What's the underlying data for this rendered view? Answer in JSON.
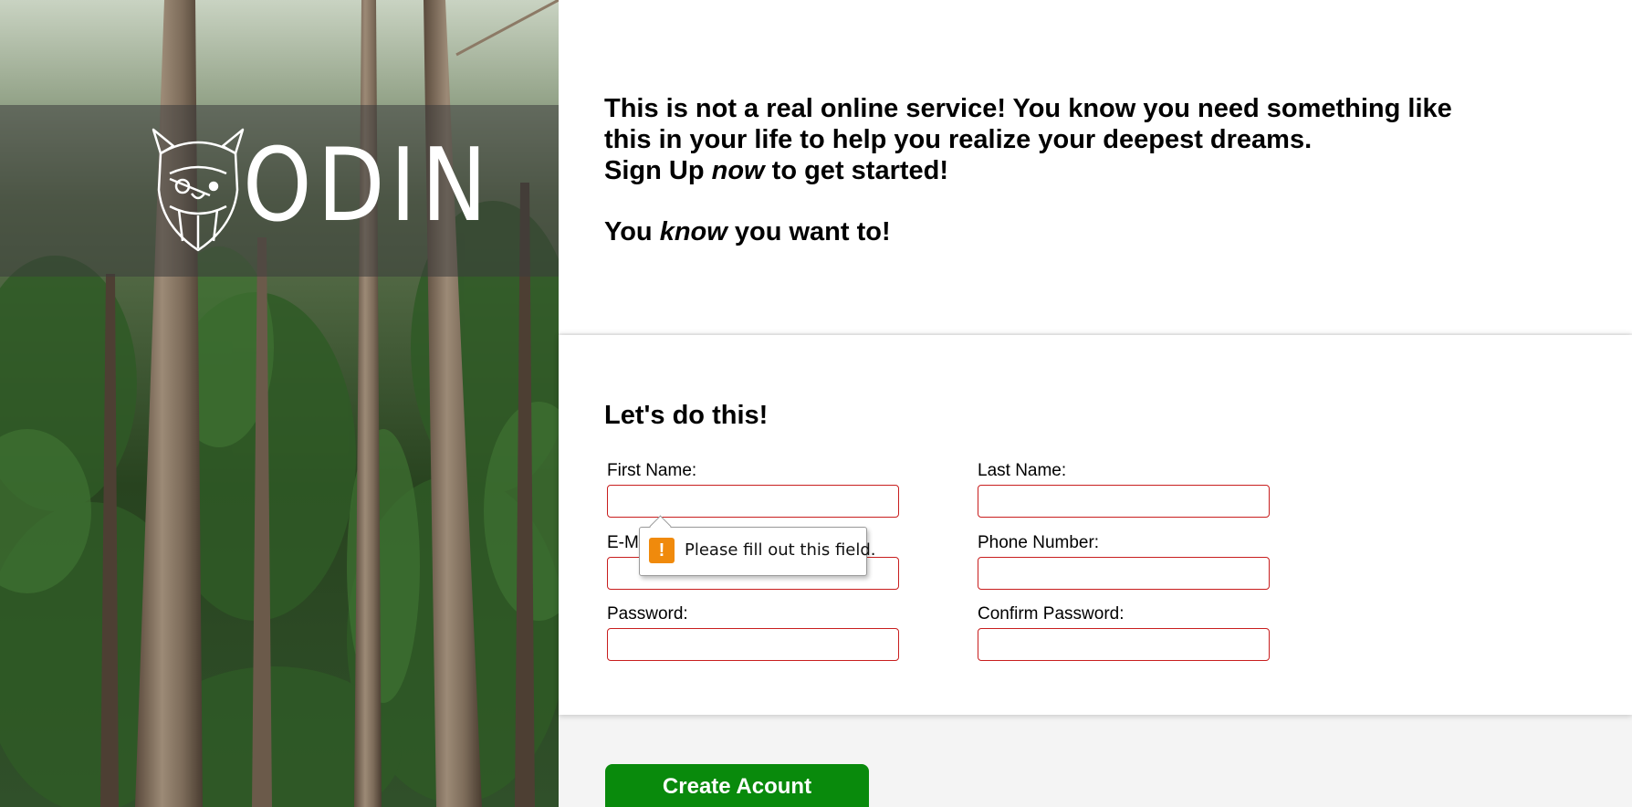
{
  "brand": {
    "logo_text": "ODIN"
  },
  "hero": {
    "line1_bold": "This is not a real online service! You know you need something like this in your life to help you realize your deepest dreams.",
    "line2_pre": "Sign Up ",
    "line2_em": "now",
    "line2_post": " to get started!",
    "line3_pre": "You ",
    "line3_em": "know",
    "line3_post": " you want to!"
  },
  "form": {
    "title": "Let's do this!",
    "fields": {
      "first_name": {
        "label": "First Name:",
        "value": ""
      },
      "last_name": {
        "label": "Last Name:",
        "value": ""
      },
      "email": {
        "label": "E-Mail:",
        "value": ""
      },
      "phone": {
        "label": "Phone Number:",
        "value": ""
      },
      "password": {
        "label": "Password:",
        "value": ""
      },
      "confirm_password": {
        "label": "Confirm Password:",
        "value": ""
      }
    },
    "validation_tooltip": "Please fill out this field.",
    "submit_label": "Create Acount"
  },
  "colors": {
    "invalid_border": "#c81e1e",
    "button_bg": "#098a0c",
    "warning_icon": "#f08a0c"
  },
  "icons": {
    "logo": "viking-helmet-icon",
    "warning": "exclamation-warning-icon"
  }
}
